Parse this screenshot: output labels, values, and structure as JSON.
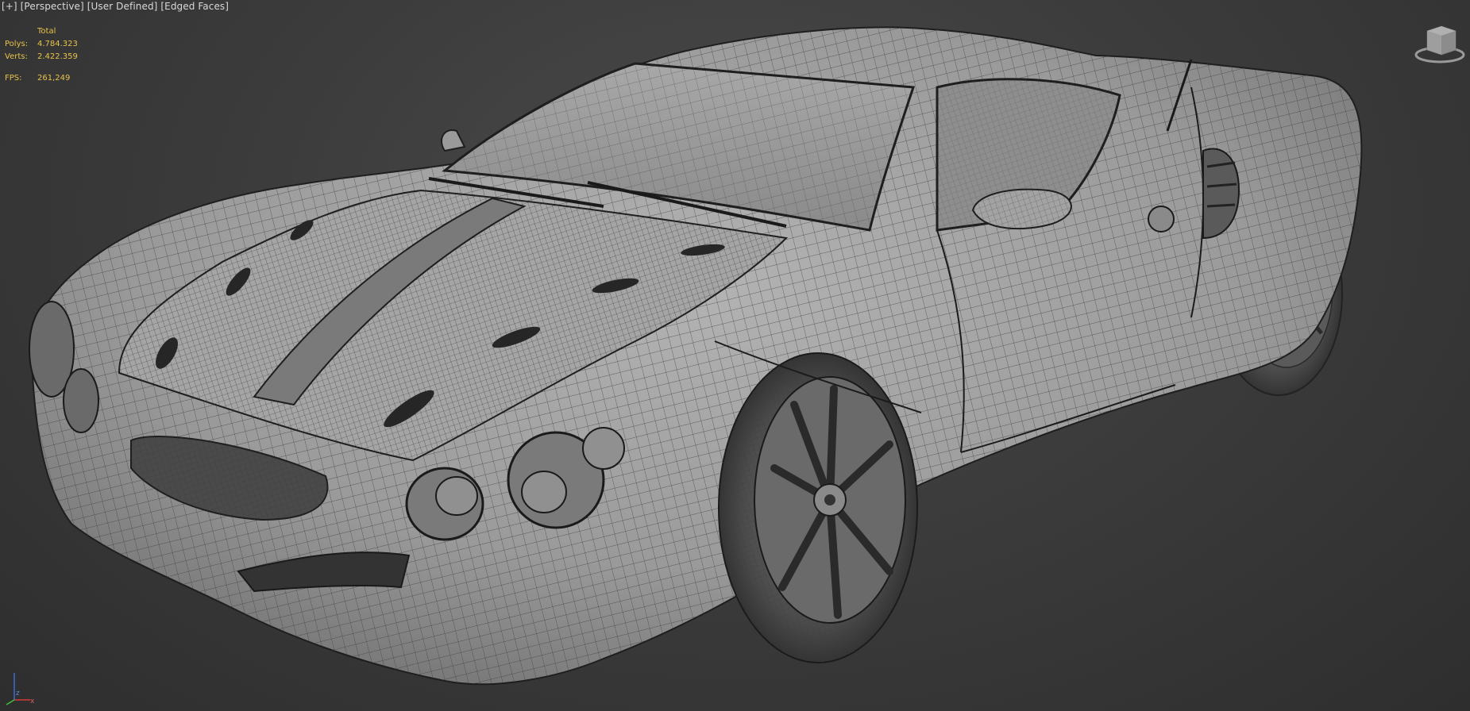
{
  "viewport": {
    "label_plus": "[+]",
    "label_view": "[Perspective]",
    "label_mode": "[User Defined]",
    "label_shading": "[Edged Faces]"
  },
  "stats": {
    "header": "Total",
    "polys_label": "Polys:",
    "polys_value": "4.784.323",
    "verts_label": "Verts:",
    "verts_value": "2.422.359",
    "fps_label": "FPS:",
    "fps_value": "261,249"
  },
  "colors": {
    "stats_text": "#e8c24a",
    "viewport_bg": "#3a3a3a",
    "model_surface": "#9c9c9c",
    "wire": "#2a2a2a",
    "axis_x": "#d23c3c",
    "axis_y": "#3cc23c",
    "axis_z": "#3c6cd2"
  },
  "model": {
    "subject": "sports car 3D model with edged-faces wireframe",
    "icon": "car-model"
  },
  "gizmos": {
    "viewcube": "viewcube-icon",
    "axis": "axis-tripod-icon"
  }
}
